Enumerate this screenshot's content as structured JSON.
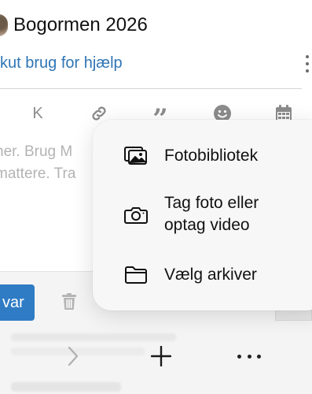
{
  "header": {
    "title": "Bogormen 2026",
    "subtitle": "kut brug for hjælp"
  },
  "editor": {
    "toolbar": {
      "k_label": "K",
      "quote_label": "”"
    },
    "placeholder_lines": [
      "her. Brug M",
      "mattere. Tra"
    ]
  },
  "footer": {
    "send_label": "var"
  },
  "popup_menu": {
    "items": [
      {
        "label": "Fotobibliotek",
        "icon": "photo-library-icon"
      },
      {
        "label_line1": "Tag foto eller",
        "label_line2": "optag video",
        "icon": "camera-icon"
      },
      {
        "label": "Vælg arkiver",
        "icon": "folder-icon"
      }
    ]
  },
  "colors": {
    "accent": "#2f75b5",
    "send_button": "#2f7bc4"
  }
}
